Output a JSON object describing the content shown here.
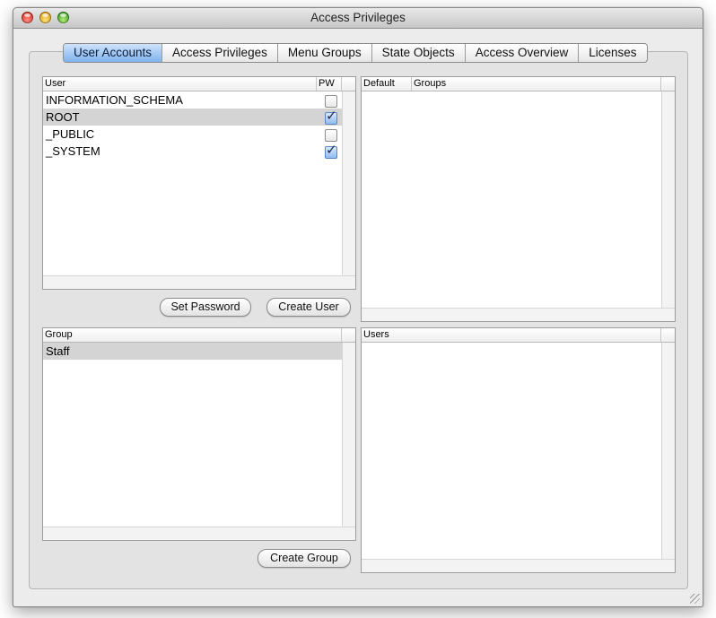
{
  "window": {
    "title": "Access Privileges"
  },
  "tabs": [
    {
      "label": "User Accounts",
      "active": true
    },
    {
      "label": "Access Privileges",
      "active": false
    },
    {
      "label": "Menu Groups",
      "active": false
    },
    {
      "label": "State Objects",
      "active": false
    },
    {
      "label": "Access Overview",
      "active": false
    },
    {
      "label": "Licenses",
      "active": false
    }
  ],
  "users_table": {
    "columns": {
      "user": "User",
      "pw": "PW"
    },
    "rows": [
      {
        "name": "INFORMATION_SCHEMA",
        "pw": false,
        "selected": false
      },
      {
        "name": "ROOT",
        "pw": true,
        "selected": true
      },
      {
        "name": "_PUBLIC",
        "pw": false,
        "selected": false
      },
      {
        "name": "_SYSTEM",
        "pw": true,
        "selected": false
      }
    ]
  },
  "user_groups_table": {
    "columns": {
      "default": "Default",
      "groups": "Groups"
    }
  },
  "buttons": {
    "set_password": "Set Password",
    "create_user": "Create User",
    "create_group": "Create Group"
  },
  "groups_table": {
    "columns": {
      "group": "Group"
    },
    "rows": [
      {
        "name": "Staff",
        "selected": true
      }
    ]
  },
  "group_users_table": {
    "columns": {
      "users": "Users"
    }
  }
}
